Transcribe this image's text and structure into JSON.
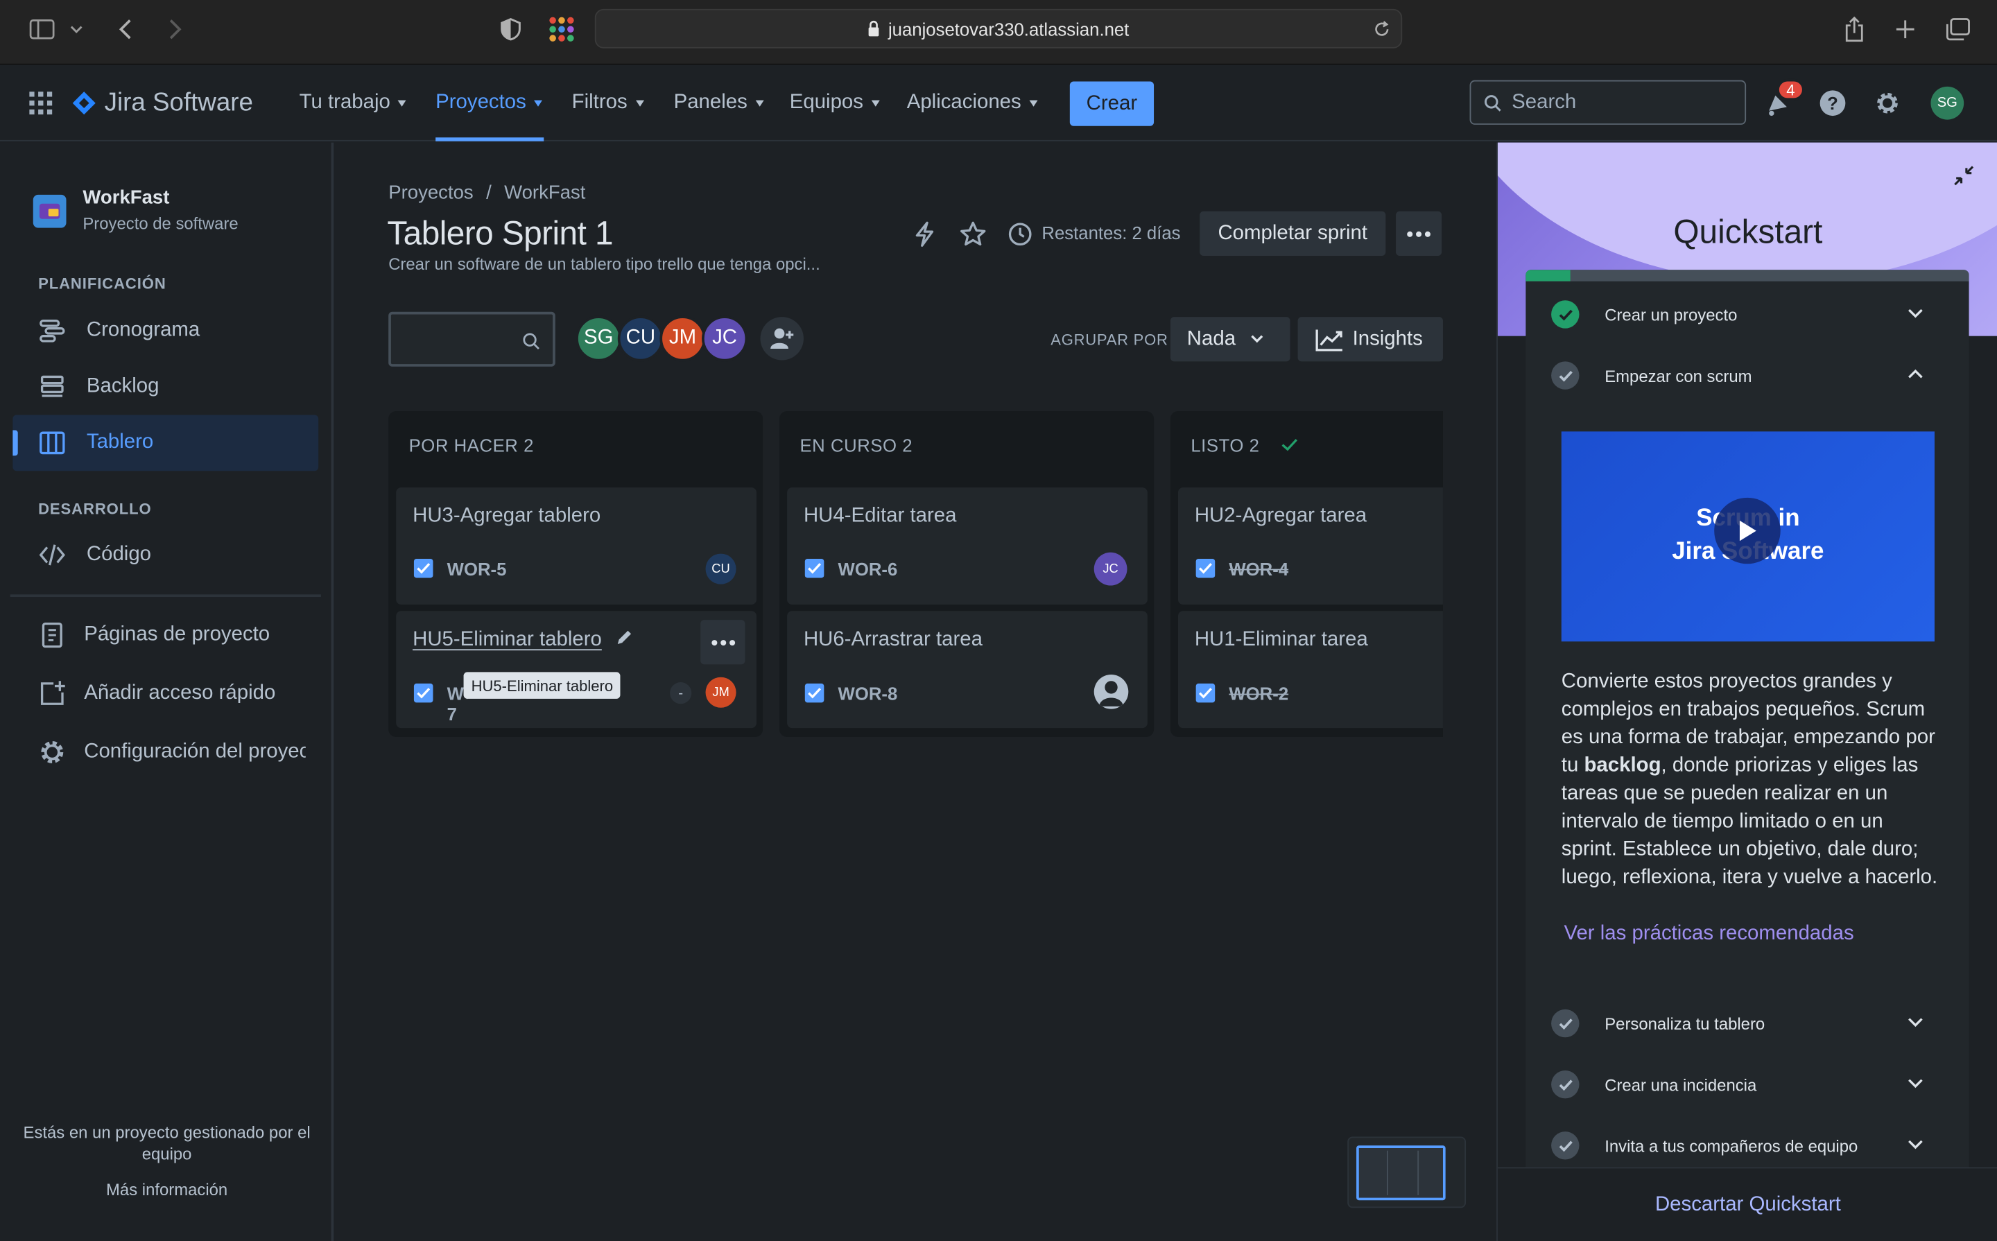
{
  "browser": {
    "url": "juanjosetovar330.atlassian.net"
  },
  "nav": {
    "brand": "Jira Software",
    "items": [
      {
        "label": "Tu trabajo"
      },
      {
        "label": "Proyectos"
      },
      {
        "label": "Filtros"
      },
      {
        "label": "Paneles"
      },
      {
        "label": "Equipos"
      },
      {
        "label": "Aplicaciones"
      }
    ],
    "active_item": "Proyectos",
    "create_label": "Crear",
    "search_placeholder": "Search",
    "notifications_count": "4",
    "user_initials": "SG"
  },
  "sidebar": {
    "project_name": "WorkFast",
    "project_type": "Proyecto de software",
    "planning_heading": "PLANIFICACIÓN",
    "planning_items": [
      {
        "label": "Cronograma",
        "icon": "timeline-icon"
      },
      {
        "label": "Backlog",
        "icon": "backlog-icon"
      },
      {
        "label": "Tablero",
        "icon": "board-icon"
      }
    ],
    "dev_heading": "DESARROLLO",
    "dev_items": [
      {
        "label": "Código",
        "icon": "code-icon"
      }
    ],
    "extra_items": [
      {
        "label": "Páginas de proyecto",
        "icon": "pages-icon"
      },
      {
        "label": "Añadir acceso rápido",
        "icon": "add-shortcut-icon"
      },
      {
        "label": "Configuración del proyecto",
        "icon": "settings-icon"
      }
    ],
    "footer_text": "Estás en un proyecto gestionado por el equipo",
    "footer_link": "Más información"
  },
  "board": {
    "breadcrumb": [
      "Proyectos",
      "WorkFast"
    ],
    "title": "Tablero Sprint 1",
    "description": "Crear un software de un tablero tipo trello que tenga opci...",
    "remaining": "Restantes: 2 días",
    "complete_sprint": "Completar sprint",
    "group_by_label": "AGRUPAR POR",
    "group_by_value": "Nada",
    "insights_label": "Insights",
    "members": [
      {
        "initials": "SG",
        "color": "#2e7d5b"
      },
      {
        "initials": "CU",
        "color": "#1f3a5f"
      },
      {
        "initials": "JM",
        "color": "#d04a24"
      },
      {
        "initials": "JC",
        "color": "#5e4db2"
      }
    ],
    "columns": [
      {
        "title": "POR HACER 2",
        "cards": [
          {
            "title": "HU3-Agregar tablero",
            "key": "WOR-5",
            "assignee": "CU",
            "assignee_color": "#1f3a5f"
          },
          {
            "title": "HU5-Eliminar tablero",
            "key": "WOR-7",
            "assignee": "JM",
            "assignee_color": "#d04a24"
          }
        ]
      },
      {
        "title": "EN CURSO 2",
        "cards": [
          {
            "title": "HU4-Editar tarea",
            "key": "WOR-6",
            "assignee": "JC",
            "assignee_color": "#5e4db2"
          },
          {
            "title": "HU6-Arrastrar tarea",
            "key": "WOR-8",
            "assignee": "",
            "assignee_color": "#8c9bab"
          }
        ]
      },
      {
        "title": "LISTO 2",
        "cards": [
          {
            "title": "HU2-Agregar tarea",
            "key": "WOR-4"
          },
          {
            "title": "HU1-Eliminar tarea",
            "key": "WOR-2"
          }
        ]
      }
    ],
    "tooltip": "HU5-Eliminar tablero",
    "estimate_placeholder": "-"
  },
  "quickstart": {
    "title": "Quickstart",
    "progress": 0.1,
    "items": [
      {
        "label": "Crear un proyecto",
        "done": true
      },
      {
        "label": "Empezar con scrum",
        "done": false
      },
      {
        "label": "Personaliza tu tablero",
        "done": false
      },
      {
        "label": "Crear una incidencia",
        "done": false
      },
      {
        "label": "Invita a tus compañeros de equipo",
        "done": false
      }
    ],
    "video_title_line1": "Scrum in",
    "video_title_line2": "Jira Software",
    "body_before": "Convierte estos proyectos grandes y complejos en trabajos pequeños. Scrum es una forma de trabajar, empezando por tu ",
    "body_bold": "backlog",
    "body_after": ", donde priorizas y eliges las tareas que se pueden realizar en un intervalo de tiempo limitado o en un sprint. Establece un objetivo, dale duro; luego, reflexiona, itera y vuelve a hacerlo.",
    "link": "Ver las prácticas recomendadas",
    "dismiss": "Descartar Quickstart"
  },
  "colors": {
    "accent": "#579dff",
    "done_green": "#22a06b",
    "quickstart_purple": "#8f7ee7"
  }
}
